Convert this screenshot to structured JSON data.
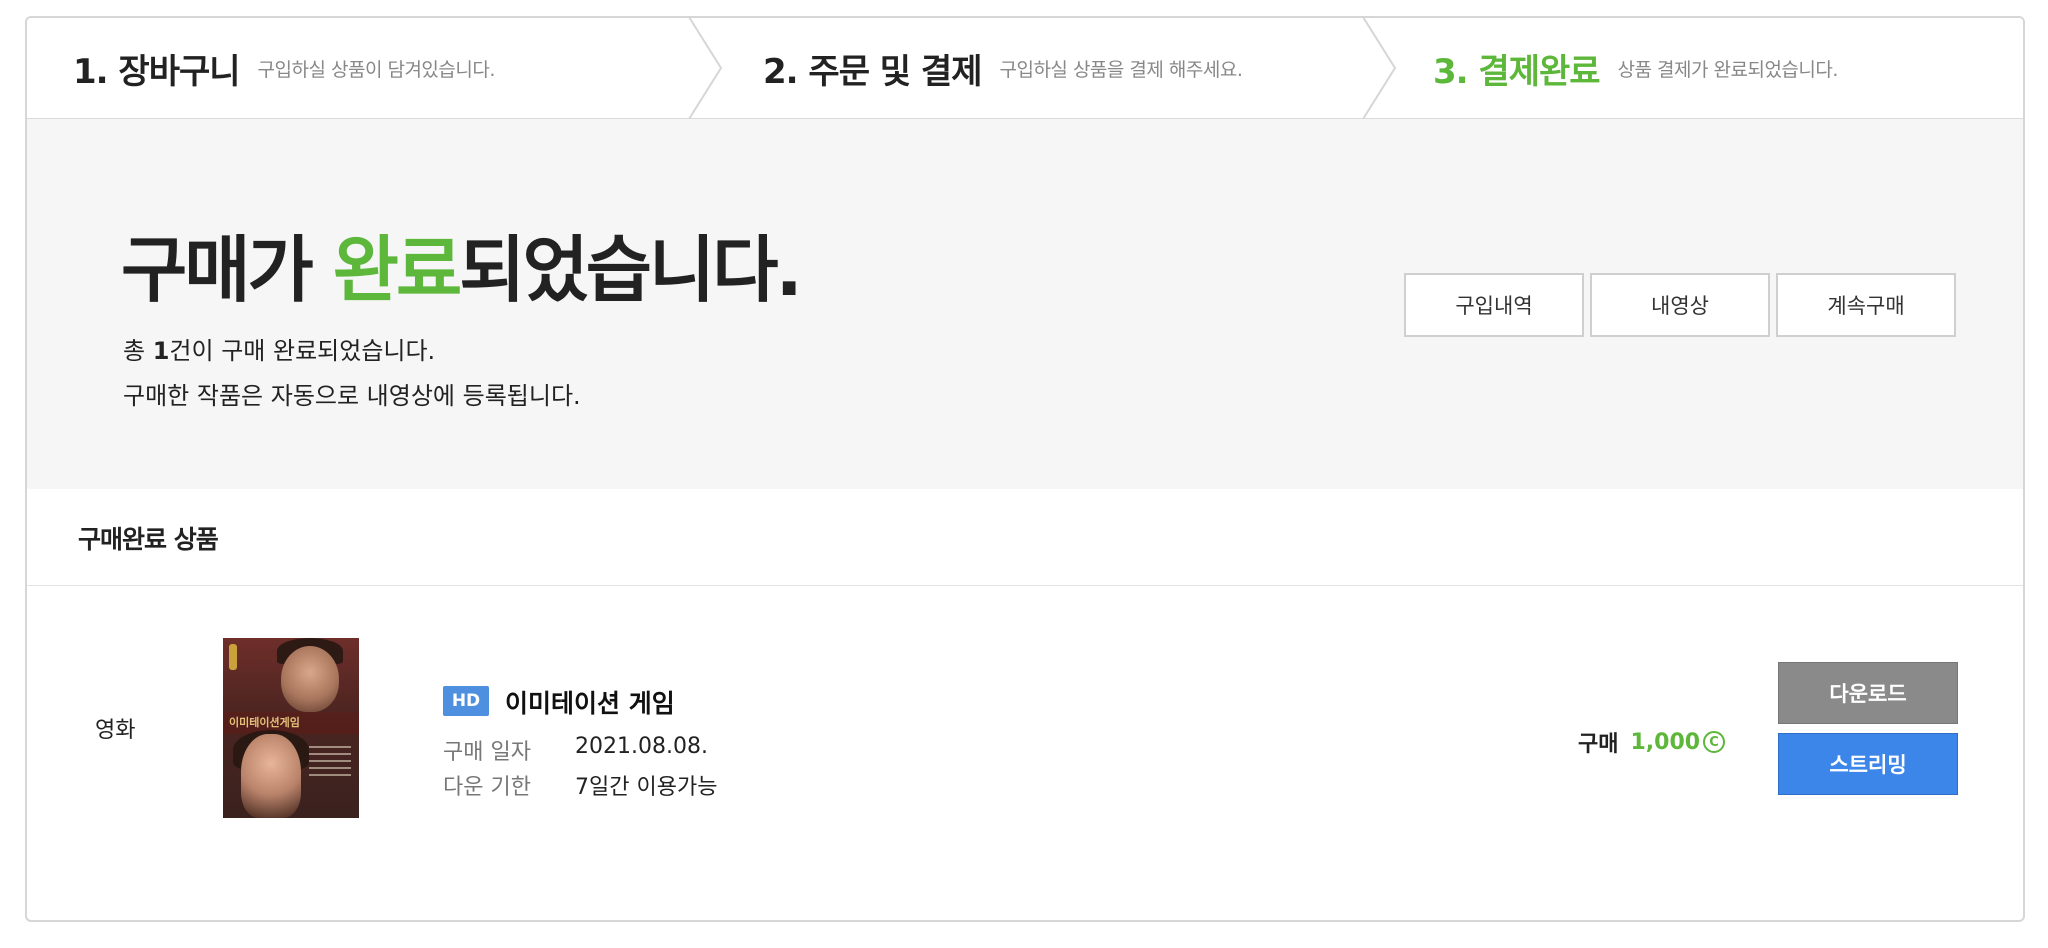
{
  "steps": [
    {
      "title": "1. 장바구니",
      "desc": "구입하실 상품이 담겨있습니다.",
      "active": false
    },
    {
      "title": "2. 주문 및 결제",
      "desc": "구입하실 상품을 결제 해주세요.",
      "active": false
    },
    {
      "title": "3. 결제완료",
      "desc": "상품 결제가 완료되었습니다.",
      "active": true
    }
  ],
  "hero": {
    "title_prefix": "구매가 ",
    "title_accent": "완료",
    "title_suffix": "되었습니다.",
    "line1_prefix": "총 ",
    "line1_count": "1",
    "line1_suffix": "건이 구매 완료되었습니다.",
    "line2": "구매한 작품은 자동으로 내영상에 등록됩니다."
  },
  "hero_buttons": {
    "history": "구입내역",
    "my_videos": "내영상",
    "continue": "계속구매"
  },
  "section": {
    "title": "구매완료 상품"
  },
  "product": {
    "category": "영화",
    "quality_badge": "HD",
    "title": "이미테이션 게임",
    "poster_title": "이미테이션게임",
    "purchase_date_label": "구매 일자",
    "purchase_date": "2021.08.08.",
    "download_period_label": "다운 기한",
    "download_period": "7일간 이용가능",
    "price_label": "구매",
    "price": "1,000",
    "currency_symbol": "C",
    "download_button": "다운로드",
    "streaming_button": "스트리밍"
  },
  "colors": {
    "accent_green": "#5cb73a",
    "hd_blue": "#4f8fdf",
    "stream_blue": "#3b86e8",
    "download_gray": "#8a8a8a"
  }
}
